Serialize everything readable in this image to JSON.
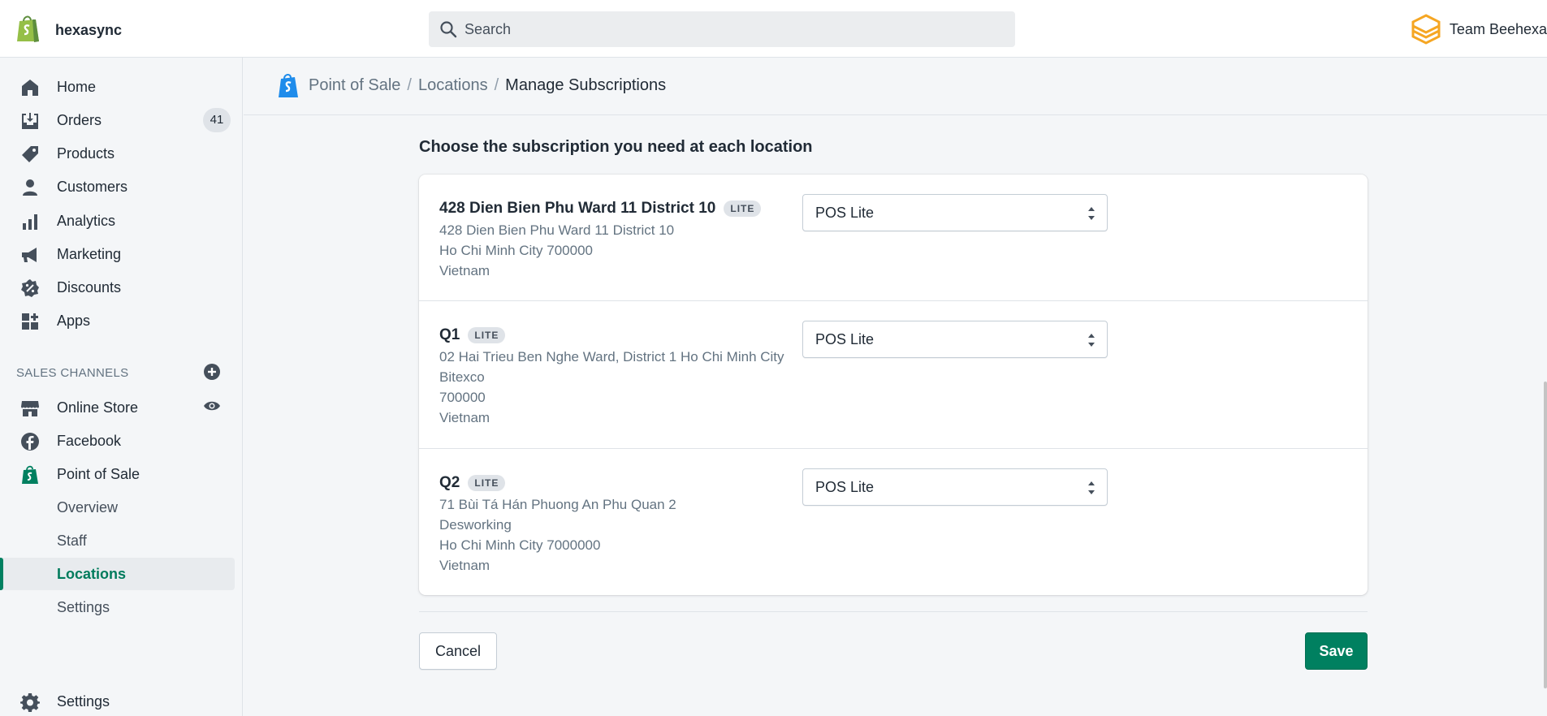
{
  "topbar": {
    "store_name": "hexasync",
    "search_placeholder": "Search",
    "account_name": "Team Beehexa"
  },
  "sidebar": {
    "items": [
      {
        "label": "Home",
        "icon": "home-icon"
      },
      {
        "label": "Orders",
        "icon": "orders-icon",
        "badge": "41"
      },
      {
        "label": "Products",
        "icon": "tag-icon"
      },
      {
        "label": "Customers",
        "icon": "person-icon"
      },
      {
        "label": "Analytics",
        "icon": "bar-chart-icon"
      },
      {
        "label": "Marketing",
        "icon": "megaphone-icon"
      },
      {
        "label": "Discounts",
        "icon": "discount-icon"
      },
      {
        "label": "Apps",
        "icon": "apps-icon"
      }
    ],
    "sales_channels_label": "SALES CHANNELS",
    "channels": [
      {
        "label": "Online Store",
        "icon": "store-icon"
      },
      {
        "label": "Facebook",
        "icon": "facebook-icon"
      },
      {
        "label": "Point of Sale",
        "icon": "shopify-bag-icon"
      }
    ],
    "pos_subitems": [
      {
        "label": "Overview"
      },
      {
        "label": "Staff"
      },
      {
        "label": "Locations"
      },
      {
        "label": "Settings"
      }
    ],
    "settings_label": "Settings"
  },
  "breadcrumb": {
    "items": [
      "Point of Sale",
      "Locations"
    ],
    "separator": "/",
    "current": "Manage Subscriptions"
  },
  "main": {
    "section_title": "Choose the subscription you need at each location",
    "locations": [
      {
        "name": "428 Dien Bien Phu Ward 11 District 10",
        "badge": "LITE",
        "address_lines": [
          "428 Dien Bien Phu Ward 11 District 10",
          "Ho Chi Minh City 700000",
          "Vietnam"
        ],
        "subscription": "POS Lite"
      },
      {
        "name": "Q1",
        "badge": "LITE",
        "address_lines": [
          "02 Hai Trieu Ben Nghe Ward, District 1 Ho Chi Minh City",
          "Bitexco",
          "700000",
          "Vietnam"
        ],
        "subscription": "POS Lite"
      },
      {
        "name": "Q2",
        "badge": "LITE",
        "address_lines": [
          "71 Bùi Tá Hán Phuong An Phu Quan 2",
          "Desworking",
          "Ho Chi Minh City 7000000",
          "Vietnam"
        ],
        "subscription": "POS Lite"
      }
    ],
    "cancel_label": "Cancel",
    "save_label": "Save"
  },
  "colors": {
    "accent_green": "#008060",
    "active_text": "#007b5c",
    "shopify_green": "#95bf47",
    "team_logo_orange": "#f5a623"
  }
}
